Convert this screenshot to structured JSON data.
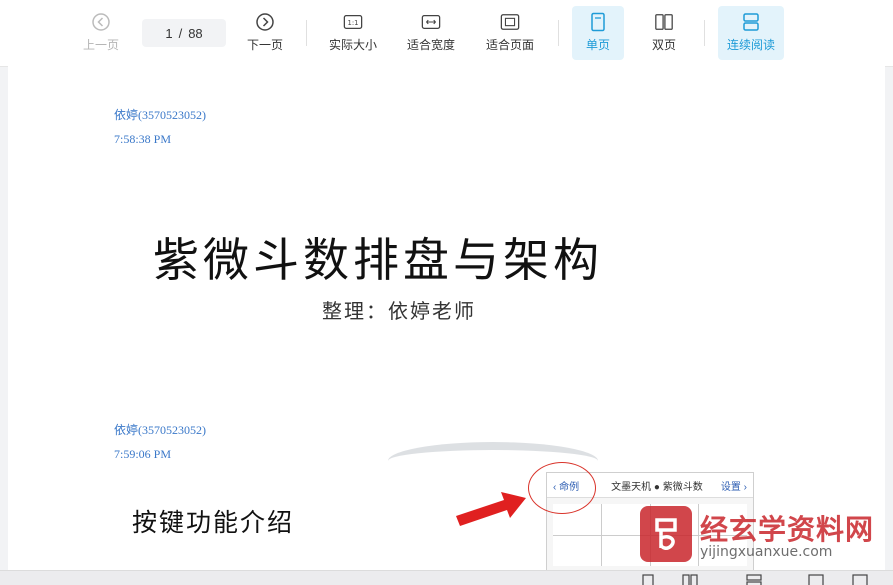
{
  "toolbar": {
    "prev_label": "上一页",
    "page_current": "1",
    "page_separator": "/",
    "page_total": "88",
    "next_label": "下一页",
    "actual_size_label": "实际大小",
    "actual_size_icon_text": "1:1",
    "fit_width_label": "适合宽度",
    "fit_page_label": "适合页面",
    "single_page_label": "单页",
    "double_page_label": "双页",
    "continuous_label": "连续阅读",
    "accent_color": "#1e9bd7"
  },
  "document": {
    "msg1": {
      "sender": "依婷(3570523052)",
      "time": "7:58:38 PM"
    },
    "title": "紫微斗数排盘与架构",
    "subtitle": "整理：依婷老师",
    "msg2": {
      "sender": "依婷(3570523052)",
      "time": "7:59:06 PM"
    },
    "section_title": "按键功能介绍",
    "phone": {
      "back_label": "命例",
      "title": "文墨天机 ● 紫微斗数",
      "settings_label": "设置"
    }
  },
  "watermark": {
    "name": "经玄学资料网",
    "url": "yijingxuanxue.com"
  }
}
